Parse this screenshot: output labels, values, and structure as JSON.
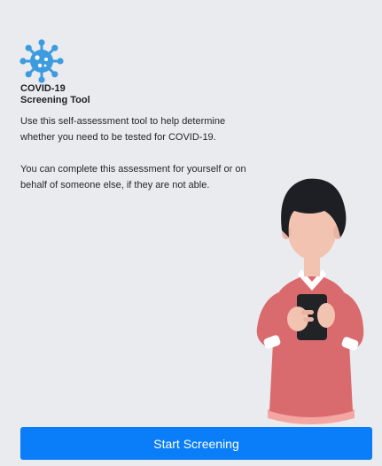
{
  "app": {
    "title_line1": "COVID-19",
    "title_line2": "Screening Tool",
    "icon": "virus-icon",
    "accent_color": "#0a7df8",
    "icon_color": "#3d9be0"
  },
  "content": {
    "paragraph1": "Use this self-assessment tool to help determine whether you need to be tested for COVID-19.",
    "paragraph2": "You can complete this assessment for yourself or on behalf of someone else, if they are not able."
  },
  "actions": {
    "start_label": "Start Screening"
  }
}
